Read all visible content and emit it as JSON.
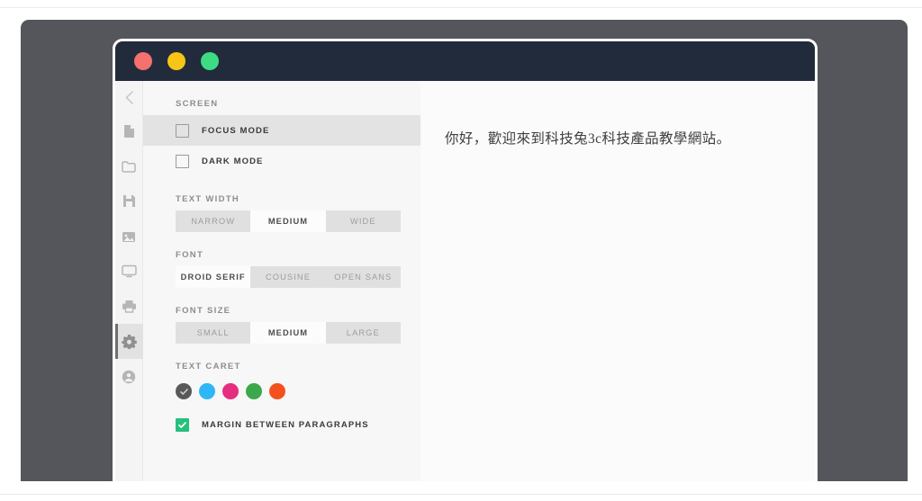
{
  "window": {
    "titlebar": {
      "buttons": [
        {
          "name": "close-button",
          "icon": "close-traffic-light",
          "color": "#f4716e"
        },
        {
          "name": "minimize-button",
          "icon": "minimize-traffic-light",
          "color": "#f7c516"
        },
        {
          "name": "maximize-button",
          "icon": "maximize-traffic-light",
          "color": "#3ddc84"
        }
      ],
      "background": "#222b3c"
    }
  },
  "rail": {
    "back_icon": "chevron-left-icon",
    "items": [
      {
        "icon": "document-icon",
        "active": false
      },
      {
        "icon": "folder-icon",
        "active": false
      },
      {
        "icon": "save-floppy-icon",
        "active": false
      },
      {
        "icon": "image-icon",
        "active": false
      },
      {
        "icon": "monitor-icon",
        "active": false
      },
      {
        "icon": "printer-icon",
        "active": false
      },
      {
        "icon": "gear-icon",
        "active": true
      },
      {
        "icon": "account-user-icon",
        "active": false
      }
    ]
  },
  "settings": {
    "sections": {
      "screen": {
        "label": "SCREEN",
        "toggles": [
          {
            "label": "FOCUS MODE",
            "checked": false,
            "highlighted": true
          },
          {
            "label": "DARK MODE",
            "checked": false,
            "highlighted": false
          }
        ]
      },
      "text_width": {
        "label": "TEXT WIDTH",
        "options": [
          "NARROW",
          "MEDIUM",
          "WIDE"
        ],
        "selected": "MEDIUM"
      },
      "font": {
        "label": "FONT",
        "options": [
          "DROID SERIF",
          "COUSINE",
          "OPEN SANS"
        ],
        "selected": "DROID SERIF"
      },
      "font_size": {
        "label": "FONT SIZE",
        "options": [
          "SMALL",
          "MEDIUM",
          "LARGE"
        ],
        "selected": "MEDIUM"
      },
      "text_caret": {
        "label": "TEXT CARET",
        "swatches": [
          {
            "color": "#595959",
            "selected": true
          },
          {
            "color": "#2fb6f7",
            "selected": false
          },
          {
            "color": "#e62d7f",
            "selected": false
          },
          {
            "color": "#3da84b",
            "selected": false
          },
          {
            "color": "#f4511e",
            "selected": false
          }
        ]
      },
      "margin": {
        "toggle": {
          "label": "MARGIN BETWEEN PARAGRAPHS",
          "checked": true,
          "color": "#27c07d"
        }
      }
    }
  },
  "content": {
    "document_text": "你好，歡迎來到科技兔3c科技產品教學網站。"
  },
  "colors": {
    "backdrop": "#55565b",
    "titlebar": "#222b3c",
    "panel_bg": "#f7f7f7",
    "content_bg": "#fbfbfb",
    "rail_bg": "#f4f4f4",
    "segment_track": "#e0e0e0",
    "highlight_row": "#e3e3e3"
  }
}
